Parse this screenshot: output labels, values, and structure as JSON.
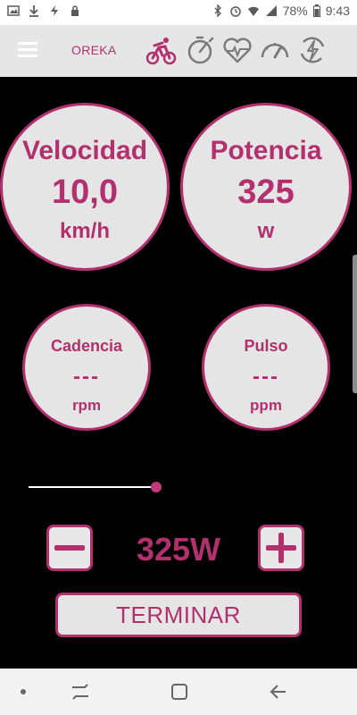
{
  "status_bar": {
    "battery": "78%",
    "time": "9:43"
  },
  "app_bar": {
    "title": "OREKA",
    "tabs": [
      {
        "icon": "cycling-icon",
        "active": true
      },
      {
        "icon": "timer-icon",
        "active": false
      },
      {
        "icon": "heart-rate-icon",
        "active": false
      },
      {
        "icon": "speedometer-icon",
        "active": false
      },
      {
        "icon": "power-bolt-icon",
        "active": false
      }
    ]
  },
  "metrics": {
    "velocidad": {
      "label": "Velocidad",
      "value": "10,0",
      "unit": "km/h"
    },
    "potencia": {
      "label": "Potencia",
      "value": "325",
      "unit": "w"
    },
    "cadencia": {
      "label": "Cadencia",
      "value": "---",
      "unit": "rpm"
    },
    "pulso": {
      "label": "Pulso",
      "value": "---",
      "unit": "ppm"
    }
  },
  "power_slider": {
    "fraction": 0.95
  },
  "power_control": {
    "value": "325W"
  },
  "actions": {
    "terminar_label": "TERMINAR"
  },
  "colors": {
    "accent": "#b3306e",
    "circle_fill": "#e5e5e5",
    "background": "#000000",
    "appbar": "#e6e6e6"
  }
}
